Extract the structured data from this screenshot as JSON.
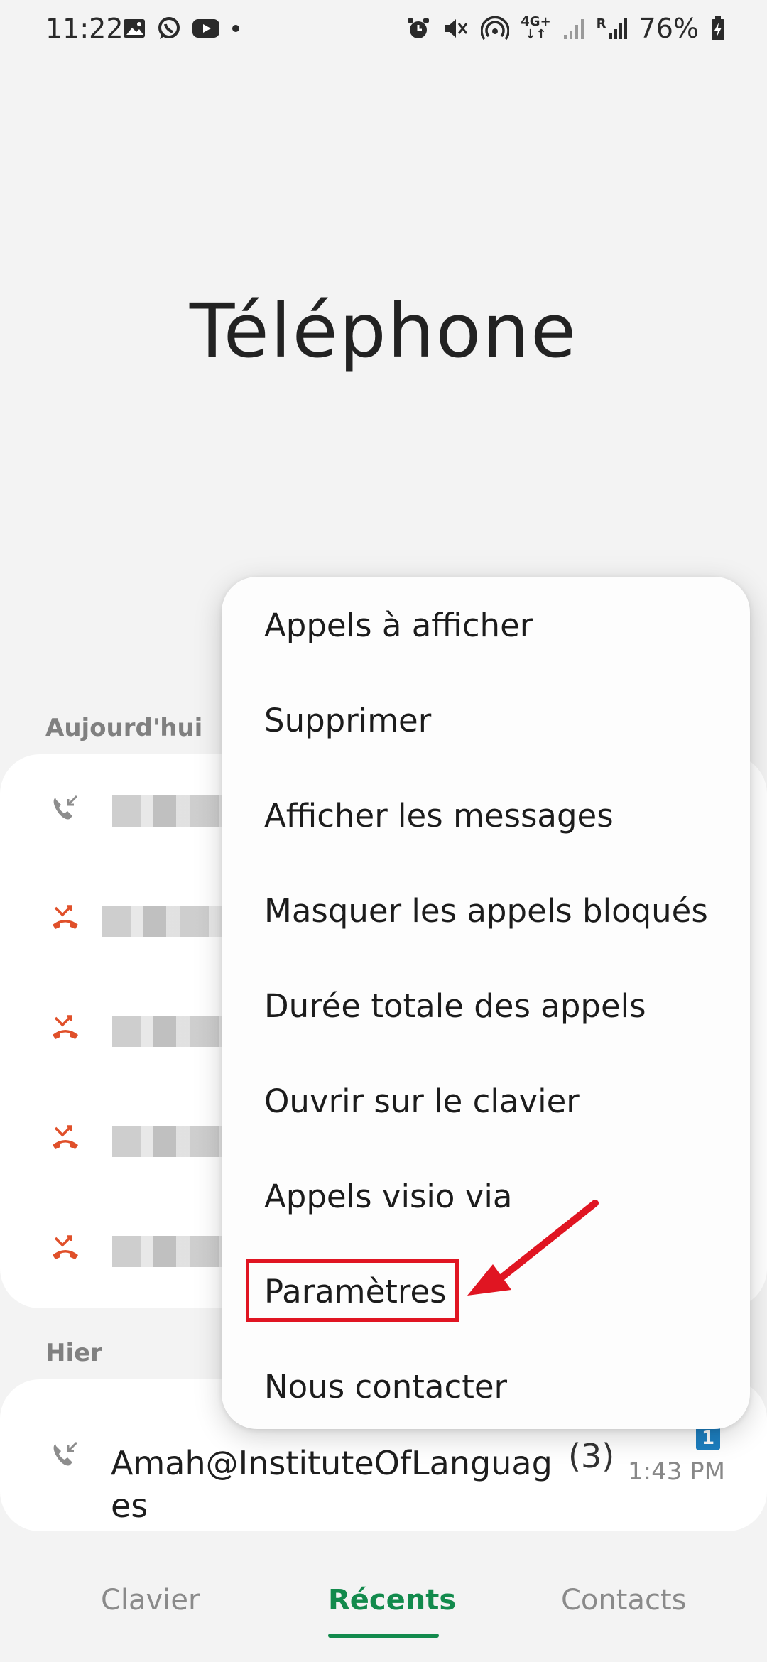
{
  "status_bar": {
    "time": "11:22",
    "battery": "76%",
    "left_icons": [
      "image-icon",
      "whatsapp-icon",
      "youtube-icon",
      "dot-icon"
    ],
    "right_icons": [
      "alarm-icon",
      "mute-icon",
      "hotspot-icon",
      "network-4g-icon",
      "signal-icon",
      "signal-roaming-icon",
      "battery-icon"
    ],
    "network_label": "4G+",
    "roaming_label": "R"
  },
  "header": {
    "title": "Téléphone"
  },
  "sections": {
    "today_label": "Aujourd'hui",
    "yesterday_label": "Hier"
  },
  "today_calls": [
    {
      "type": "incoming",
      "icon": "incoming-call-icon"
    },
    {
      "type": "missed",
      "icon": "missed-call-icon"
    },
    {
      "type": "missed",
      "icon": "missed-call-icon"
    },
    {
      "type": "missed",
      "icon": "missed-call-icon"
    },
    {
      "type": "missed",
      "icon": "missed-call-icon"
    }
  ],
  "yesterday_call": {
    "name_line1": "Amah@InstituteOfLanguag",
    "name_line2": "es",
    "count": "(3)",
    "time": "1:43 PM",
    "sim": "1"
  },
  "menu": {
    "items": [
      "Appels à afficher",
      "Supprimer",
      "Afficher les messages",
      "Masquer les appels bloqués",
      "Durée totale des appels",
      "Ouvrir sur le clavier",
      "Appels visio via",
      "Paramètres",
      "Nous contacter"
    ]
  },
  "bottom_nav": {
    "tabs": [
      "Clavier",
      "Récents",
      "Contacts"
    ],
    "active_index": 1
  },
  "colors": {
    "accent": "#128a4c",
    "missed": "#e0502a",
    "highlight": "#e01522",
    "sim_badge": "#1d7fc0"
  }
}
